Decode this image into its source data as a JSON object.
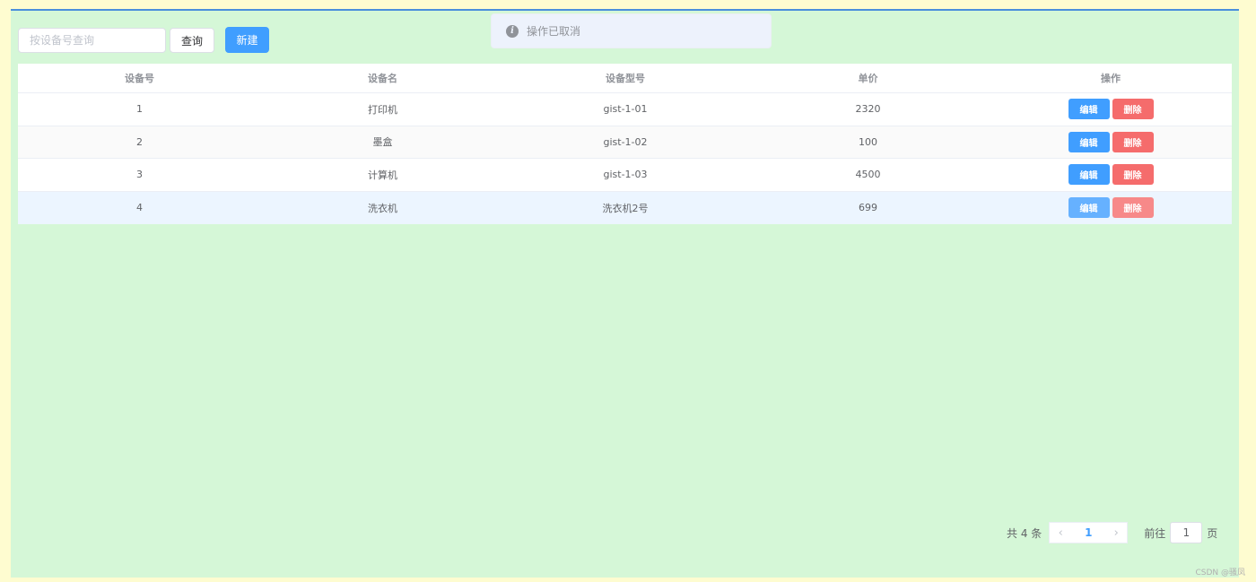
{
  "toolbar": {
    "search_placeholder": "按设备号查询",
    "query_label": "查询",
    "new_label": "新建"
  },
  "message": {
    "icon": "info-icon",
    "text": "操作已取消"
  },
  "table": {
    "columns": [
      "设备号",
      "设备名",
      "设备型号",
      "单价",
      "操作"
    ],
    "rows": [
      {
        "id": "1",
        "name": "打印机",
        "model": "gist-1-01",
        "price": "2320",
        "edit": "编辑",
        "delete": "删除"
      },
      {
        "id": "2",
        "name": "墨盒",
        "model": "gist-1-02",
        "price": "100",
        "edit": "编辑",
        "delete": "删除"
      },
      {
        "id": "3",
        "name": "计算机",
        "model": "gist-1-03",
        "price": "4500",
        "edit": "编辑",
        "delete": "删除"
      },
      {
        "id": "4",
        "name": "洗衣机",
        "model": "洗衣机2号",
        "price": "699",
        "edit": "编辑",
        "delete": "删除"
      }
    ]
  },
  "pagination": {
    "total_text": "共 4 条",
    "prev_icon": "chevron-left-icon",
    "current_page": "1",
    "next_icon": "chevron-right-icon",
    "goto_label": "前往",
    "goto_value": "1",
    "page_unit": "页"
  },
  "watermark": "CSDN @骚凤",
  "colors": {
    "accent": "#409eff",
    "danger": "#f56c6c",
    "panel_bg": "#d5f7d7",
    "page_bg": "#fefcd0"
  }
}
